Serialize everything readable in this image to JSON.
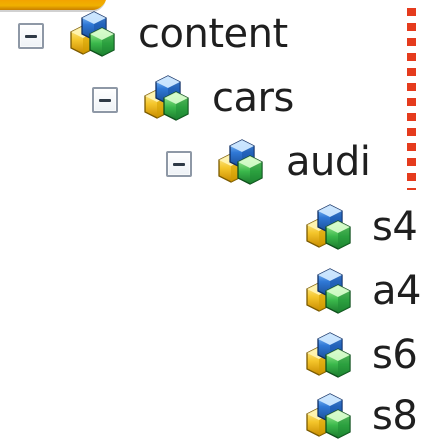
{
  "tree": {
    "nodes": {
      "content": {
        "label": "content",
        "expanded": true,
        "icon": "cubes-icon"
      },
      "cars": {
        "label": "cars",
        "expanded": true,
        "icon": "cubes-icon"
      },
      "audi": {
        "label": "audi",
        "expanded": true,
        "icon": "cubes-icon"
      },
      "s4": {
        "label": "s4",
        "icon": "cubes-icon"
      },
      "a4": {
        "label": "a4",
        "icon": "cubes-icon"
      },
      "s6": {
        "label": "s6",
        "icon": "cubes-icon"
      },
      "s8": {
        "label": "s8",
        "icon": "cubes-icon"
      }
    }
  },
  "colors": {
    "toggle_border": "#8e98a6",
    "red_marker": "#e53b1d",
    "orange_stroke": "#f2a400"
  }
}
